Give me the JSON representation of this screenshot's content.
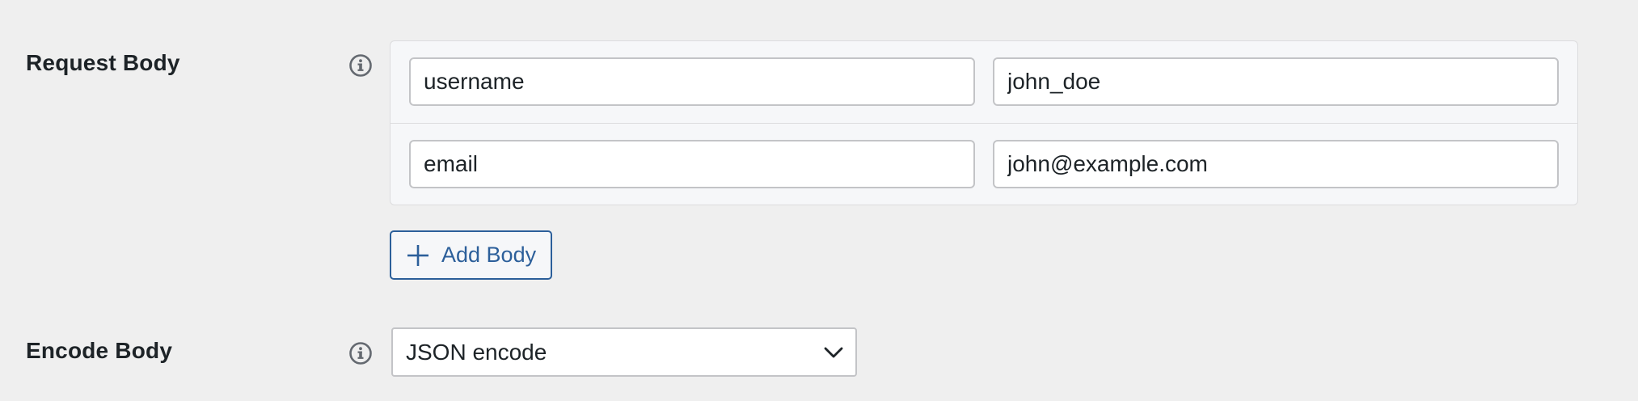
{
  "request_body": {
    "label": "Request Body",
    "info_icon": "info-circle-icon",
    "rows": [
      {
        "key": "username",
        "value": "john_doe"
      },
      {
        "key": "email",
        "value": "john@example.com"
      }
    ],
    "add_button_label": "Add Body",
    "add_icon": "plus-icon"
  },
  "encode_body": {
    "label": "Encode Body",
    "info_icon": "info-circle-icon",
    "selected": "JSON encode",
    "chevron_icon": "chevron-down-icon"
  },
  "colors": {
    "background": "#efefef",
    "accent": "#2c5f9a",
    "border": "#c3c4c7",
    "text": "#1d2327"
  }
}
